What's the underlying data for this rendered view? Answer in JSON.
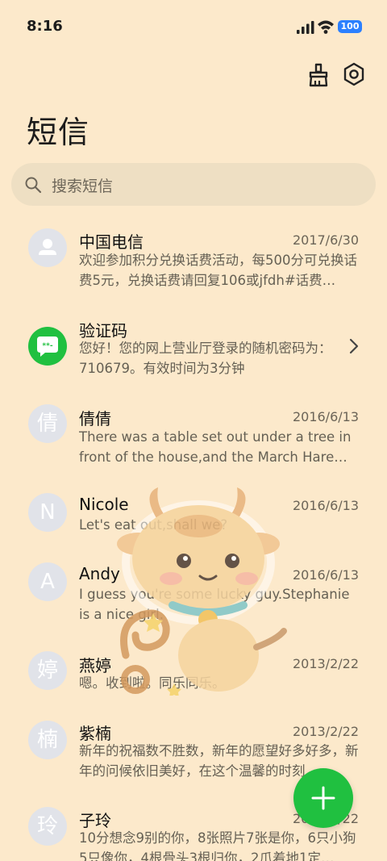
{
  "status_bar": {
    "time": "8:16",
    "battery": "100"
  },
  "header": {
    "title": "短信"
  },
  "search": {
    "placeholder": "搜索短信"
  },
  "conversations": [
    {
      "avatar_char": "",
      "avatar_type": "person-icon",
      "name": "中国电信",
      "date": "2017/6/30",
      "preview": "欢迎参加积分兑换话费活动，每500分可兑换话费5元，兑换话费请回复106或jfdh#话费…"
    },
    {
      "avatar_char": "",
      "avatar_type": "chat-bubble-icon",
      "name": "验证码",
      "date": "",
      "preview": "您好！您的网上营业厅登录的随机密码为：710679。有效时间为3分钟"
    },
    {
      "avatar_char": "倩",
      "name": "倩倩",
      "date": "2016/6/13",
      "preview": "There was a table set out under a tree in front of the house,and the March Hare an…"
    },
    {
      "avatar_char": "N",
      "name": "Nicole",
      "date": "2016/6/13",
      "preview": "Let's eat out,shall we?"
    },
    {
      "avatar_char": "A",
      "name": "Andy",
      "date": "2016/6/13",
      "preview": "I guess you're some lucky guy.Stephanie is a nice girl."
    },
    {
      "avatar_char": "婷",
      "name": "燕婷",
      "date": "2013/2/22",
      "preview": "嗯。收到啦。同乐同乐。"
    },
    {
      "avatar_char": "楠",
      "name": "紫楠",
      "date": "2013/2/22",
      "preview": "新年的祝福数不胜数，新年的愿望好多好多，新年的问候依旧美好，在这个温馨的时刻…"
    },
    {
      "avatar_char": "玲",
      "name": "子玲",
      "date": "2013/2/22",
      "preview": "10分想念9别的你，8张照片7张是你，6只小狗5只像你，4根骨头3根归你，2爪着地1定…"
    }
  ],
  "colors": {
    "background": "#fce9cb",
    "fab": "#20c040",
    "avatar": "#e1e3e9",
    "code_avatar": "#20c040"
  }
}
